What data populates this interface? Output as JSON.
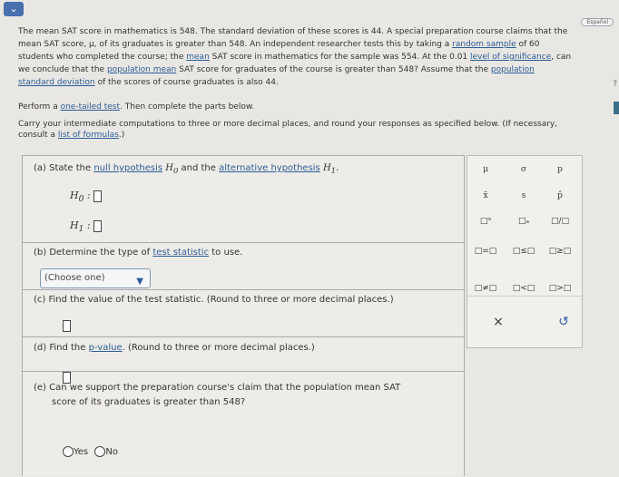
{
  "header": {
    "lang_label": "Español",
    "help_glyph": "?"
  },
  "problem": {
    "s1": "The mean SAT score in mathematics is 548. The standard deviation of these scores is 44. A special preparation course claims that the mean SAT score, μ, of its graduates is greater than 548. An independent researcher tests this by taking a ",
    "l1": "random sample",
    "s2": " of 60 students who completed the course; the ",
    "l2": "mean",
    "s3": " SAT score in mathematics for the sample was 554. At the 0.01 ",
    "l3": "level of significance",
    "s4": ", can we conclude that the ",
    "l4": "population mean",
    "s5": " SAT score for graduates of the course is greater than 548? Assume that the ",
    "l5": "population standard deviation",
    "s6": " of the scores of course graduates is also 44."
  },
  "instructions": {
    "p2a": "Perform a ",
    "p2link": "one-tailed test",
    "p2b": ". Then complete the parts below.",
    "p3a": "Carry your intermediate computations to three or more decimal places, and round your responses as specified below. (If necessary, consult a ",
    "p3link": "list of formulas",
    "p3b": ".)"
  },
  "parts": {
    "a": {
      "t1": "(a) State the ",
      "link1": "null hypothesis",
      "t2": " and the ",
      "link2": "alternative hypothesis",
      "h0": "H",
      "h0sub": "0",
      "h1": "H",
      "h1sub": "1",
      "colon": ":"
    },
    "b": {
      "t1": "(b) Determine the type of ",
      "link": "test statistic",
      "t2": " to use.",
      "select_value": "(Choose one)"
    },
    "c": {
      "text": "(c) Find the value of the test statistic. (Round to three or more decimal places.)"
    },
    "d": {
      "t1": "(d) Find the ",
      "link": "p-value",
      "t2": ". (Round to three or more decimal places.)"
    },
    "e": {
      "text1": "(e) Can we support the preparation course's claim that the population mean SAT",
      "text2": "score of its graduates is greater than 548?",
      "yes": "Yes",
      "no": "No"
    }
  },
  "keypad": {
    "row1": [
      "μ",
      "σ",
      "p"
    ],
    "row2": [
      "x̄",
      "s",
      "p̂"
    ],
    "row3": [
      "□ᵅ",
      "□ₐ",
      "□/□"
    ],
    "row4": [
      "□=□",
      "□≤□",
      "□≥□"
    ],
    "row5": [
      "□≠□",
      "□<□",
      "□>□"
    ],
    "clear": "×",
    "reset": "↺"
  }
}
